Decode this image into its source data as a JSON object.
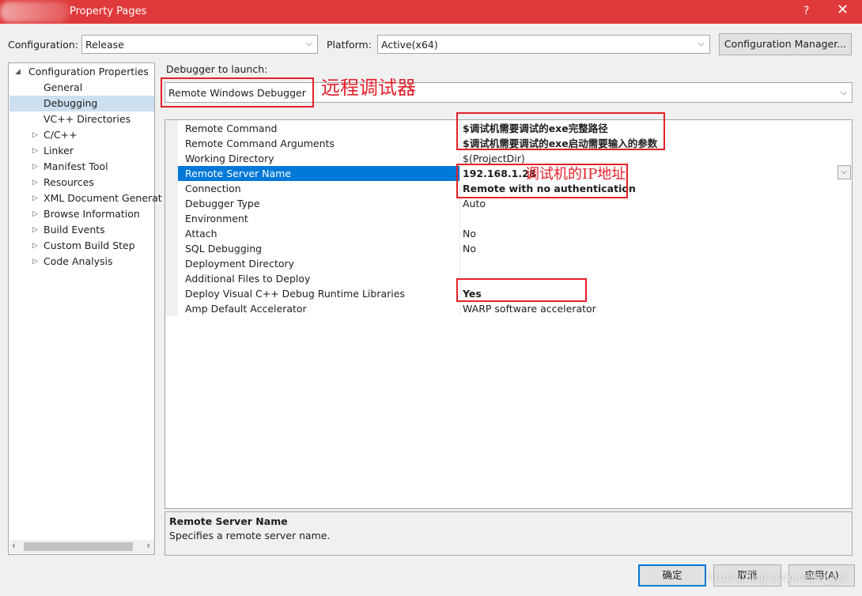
{
  "window": {
    "title": "Property Pages",
    "help_glyph": "?",
    "close_glyph": "✕"
  },
  "toolbar": {
    "configuration_label": "Configuration:",
    "configuration_value": "Release",
    "platform_label": "Platform:",
    "platform_value": "Active(x64)",
    "config_manager_label": "Configuration Manager..."
  },
  "tree": {
    "root": "Configuration Properties",
    "items": [
      {
        "label": "General",
        "expandable": false
      },
      {
        "label": "Debugging",
        "expandable": false,
        "selected": true
      },
      {
        "label": "VC++ Directories",
        "expandable": false
      },
      {
        "label": "C/C++",
        "expandable": true
      },
      {
        "label": "Linker",
        "expandable": true
      },
      {
        "label": "Manifest Tool",
        "expandable": true
      },
      {
        "label": "Resources",
        "expandable": true
      },
      {
        "label": "XML Document Generat",
        "expandable": true
      },
      {
        "label": "Browse Information",
        "expandable": true
      },
      {
        "label": "Build Events",
        "expandable": true
      },
      {
        "label": "Custom Build Step",
        "expandable": true
      },
      {
        "label": "Code Analysis",
        "expandable": true
      }
    ]
  },
  "debugger": {
    "launch_label": "Debugger to launch:",
    "launch_value": "Remote Windows Debugger"
  },
  "properties": [
    {
      "name": "Remote Command",
      "value": "$调试机需要调试的exe完整路径",
      "bold": true
    },
    {
      "name": "Remote Command Arguments",
      "value": "$调试机需要调试的exe启动需要输入的参数",
      "bold": true
    },
    {
      "name": "Working Directory",
      "value": "$(ProjectDir)",
      "bold": false
    },
    {
      "name": "Remote Server Name",
      "value": "192.168.1.28",
      "bold": true,
      "selected": true
    },
    {
      "name": "Connection",
      "value": "Remote with no authentication",
      "bold": true
    },
    {
      "name": "Debugger Type",
      "value": "Auto",
      "bold": false
    },
    {
      "name": "Environment",
      "value": "",
      "bold": false
    },
    {
      "name": "Attach",
      "value": "No",
      "bold": false
    },
    {
      "name": "SQL Debugging",
      "value": "No",
      "bold": false
    },
    {
      "name": "Deployment Directory",
      "value": "",
      "bold": false
    },
    {
      "name": "Additional Files to Deploy",
      "value": "",
      "bold": false
    },
    {
      "name": "Deploy Visual C++ Debug Runtime Libraries",
      "value": "Yes",
      "bold": true
    },
    {
      "name": "Amp Default Accelerator",
      "value": "WARP software accelerator",
      "bold": false
    }
  ],
  "description": {
    "title": "Remote Server Name",
    "text": "Specifies a remote server name."
  },
  "buttons": {
    "ok": "确定",
    "cancel": "取消",
    "apply": "应用(A)"
  },
  "annotations": {
    "remote_debugger": "远程调试器",
    "ip_address": "调试机的IP地址"
  },
  "watermark": "https://blog.csdn.net/lv_jys",
  "colors": {
    "titlebar": "#e0393a",
    "selection": "#0078d7",
    "annotation": "#e3202a"
  }
}
